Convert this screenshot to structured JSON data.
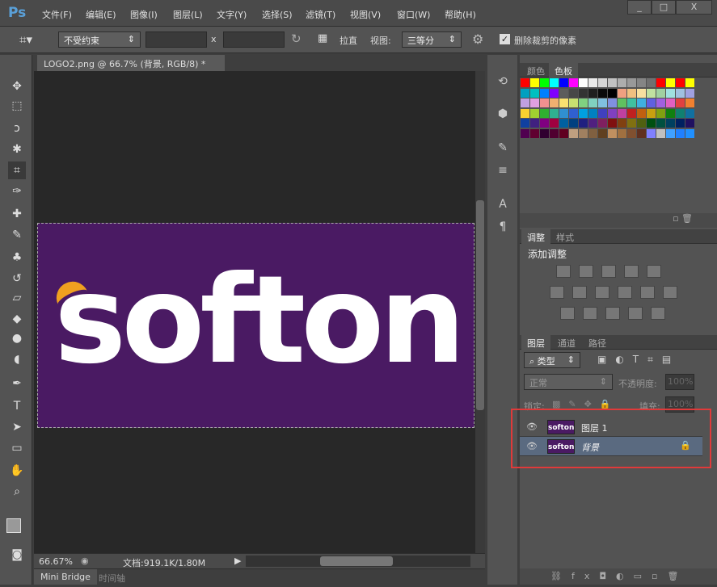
{
  "app": {
    "logo": "Ps",
    "menu": [
      "文件(F)",
      "编辑(E)",
      "图像(I)",
      "图层(L)",
      "文字(Y)",
      "选择(S)",
      "滤镜(T)",
      "视图(V)",
      "窗口(W)",
      "帮助(H)"
    ],
    "window_buttons": [
      "_",
      "□",
      "X"
    ]
  },
  "options": {
    "ratio": "不受约束",
    "width": "",
    "height": "",
    "x_label": "x",
    "straighten": "拉直",
    "view_label": "视图:",
    "view_value": "三等分",
    "delete_cropped_label": "删除裁剪的像素",
    "delete_cropped_checked": true
  },
  "document": {
    "tab_title": "LOGO2.png @ 66.7% (背景, RGB/8) *",
    "close": "×",
    "logo_text": "softon",
    "image_bg": "#4a1a63",
    "logo_accent": "#f0a020"
  },
  "status": {
    "zoom": "66.67%",
    "doc_info": "文档:919.1K/1.80M"
  },
  "bottom_tabs": [
    "Mini Bridge",
    "时间轴"
  ],
  "swatches_panel": {
    "tabs": [
      "颜色",
      "色板"
    ],
    "active": 1,
    "colors": [
      "#ff0000",
      "#ffff00",
      "#00ff00",
      "#00ffff",
      "#0000ff",
      "#ff00ff",
      "#ffffff",
      "#ebebeb",
      "#d6d6d6",
      "#c2c2c2",
      "#adadad",
      "#999999",
      "#858585",
      "#707070",
      "#ff0000",
      "#ffff00",
      "#ff0000",
      "#ffff00",
      "#00a0c0",
      "#00c0c0",
      "#0080ff",
      "#8000ff",
      "#5c5c5c",
      "#474747",
      "#333333",
      "#1f1f1f",
      "#0a0a0a",
      "#000000",
      "#f0a080",
      "#f0c080",
      "#f8e0a0",
      "#c0e0a0",
      "#a0d0a0",
      "#a0e0e0",
      "#a0c0e0",
      "#a0a0e0",
      "#c0a0e0",
      "#e0a0e0",
      "#f09090",
      "#f0b070",
      "#f8e070",
      "#c8e070",
      "#80d080",
      "#80d0c0",
      "#80c0e0",
      "#8090e0",
      "#60c060",
      "#40c0a0",
      "#40b0e0",
      "#6060e0",
      "#a060e0",
      "#e060c0",
      "#e04040",
      "#f08030",
      "#f8d030",
      "#a0d030",
      "#30b030",
      "#30b090",
      "#3090d0",
      "#3060d0",
      "#00a0e0",
      "#0080c0",
      "#4040c0",
      "#8040c0",
      "#c040a0",
      "#c02020",
      "#c06010",
      "#c8a010",
      "#80a010",
      "#108010",
      "#108070",
      "#1070a0",
      "#1040a0",
      "#402080",
      "#800080",
      "#a00040",
      "#0060a0",
      "#004080",
      "#202080",
      "#502080",
      "#802060",
      "#801010",
      "#804010",
      "#807010",
      "#506010",
      "#005010",
      "#005040",
      "#004060",
      "#002060",
      "#201060",
      "#500050",
      "#600030",
      "#300030",
      "#500030",
      "#600020",
      "#c0a080",
      "#a08060",
      "#806040",
      "#604020",
      "#c09060",
      "#a07040",
      "#805030",
      "#603020",
      "#8080ff",
      "#c0c0c0",
      "#40a0ff",
      "#2080ff",
      "#2090ff"
    ]
  },
  "adjustments_panel": {
    "tabs": [
      "调整",
      "样式"
    ],
    "title": "添加调整"
  },
  "layers_panel": {
    "tabs": [
      "图层",
      "通道",
      "路径"
    ],
    "filter": "类型",
    "blend_mode": "正常",
    "opacity_label": "不透明度:",
    "opacity": "100%",
    "lock_label": "锁定:",
    "fill_label": "填充:",
    "fill": "100%",
    "layers": [
      {
        "name": "图层 1",
        "visible": true,
        "selected": false,
        "locked": false
      },
      {
        "name": "背景",
        "visible": true,
        "selected": true,
        "locked": true
      }
    ]
  },
  "highlight_color": "#e03a3a"
}
